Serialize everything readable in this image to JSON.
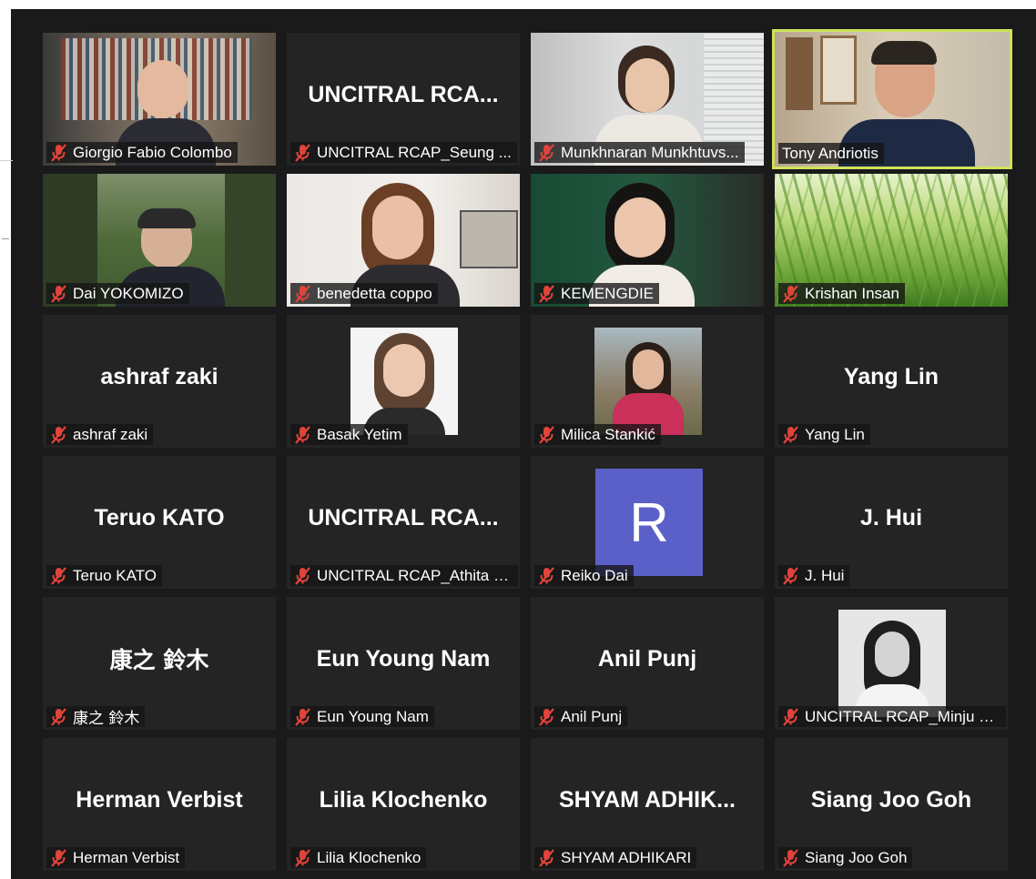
{
  "colors": {
    "background": "#1a1a1a",
    "tile": "#242424",
    "active_speaker_border": "#cfe25a",
    "muted_icon": "#e0433a",
    "avatar_purple": "#5b60c9"
  },
  "icons": {
    "muted": "microphone-muted-icon"
  },
  "participants": [
    {
      "name": "Giorgio Fabio Colombo"
    },
    {
      "name": "UNCITRAL RCAP_Seung ...",
      "display": "UNCITRAL  RCA..."
    },
    {
      "name": "Munkhnaran Munkhtuvs..."
    },
    {
      "name": "Tony Andriotis",
      "active_speaker": true
    },
    {
      "name": "Dai YOKOMIZO"
    },
    {
      "name": "benedetta coppo"
    },
    {
      "name": "KEMENGDIE"
    },
    {
      "name": "Krishan Insan"
    },
    {
      "name": "ashraf zaki",
      "display": "ashraf zaki"
    },
    {
      "name": "Basak Yetim"
    },
    {
      "name": "Milica Stankić"
    },
    {
      "name": "Yang Lin",
      "display": "Yang Lin"
    },
    {
      "name": "Teruo KATO",
      "display": "Teruo KATO"
    },
    {
      "name": "UNCITRAL RCAP_Athita K...",
      "display": "UNCITRAL  RCA..."
    },
    {
      "name": "Reiko Dai",
      "avatar_letter": "R"
    },
    {
      "name": "J. Hui",
      "display": "J. Hui"
    },
    {
      "name": "康之 鈴木",
      "display": "康之 鈴木"
    },
    {
      "name": "Eun Young Nam",
      "display": "Eun Young Nam"
    },
    {
      "name": "Anil Punj",
      "display": "Anil Punj"
    },
    {
      "name": "UNCITRAL RCAP_Minju K..."
    },
    {
      "name": "Herman Verbist",
      "display": "Herman Verbist"
    },
    {
      "name": "Lilia Klochenko",
      "display": "Lilia Klochenko"
    },
    {
      "name": "SHYAM ADHIKARI",
      "display": "SHYAM  ADHIK..."
    },
    {
      "name": "Siang Joo Goh",
      "display": "Siang Joo Goh"
    }
  ]
}
